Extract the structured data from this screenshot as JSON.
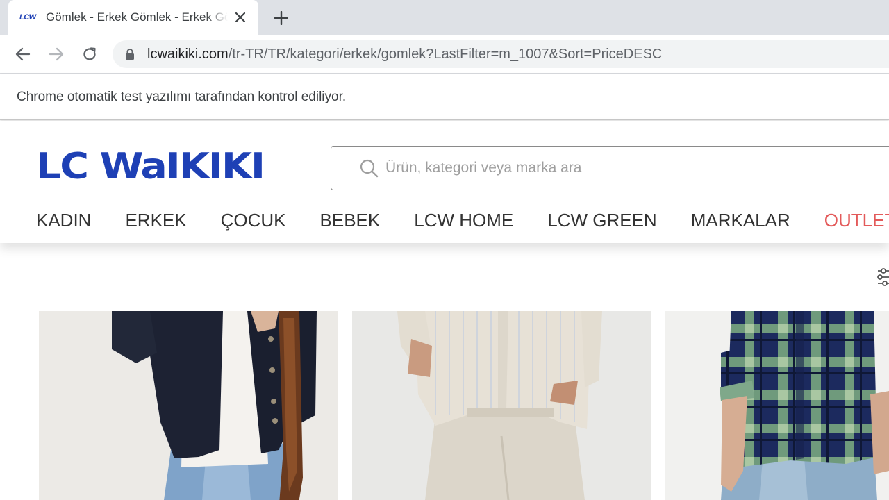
{
  "browser": {
    "tab": {
      "favicon_text": "LCW",
      "title": "Gömlek - Erkek Gömlek - Erkek Gömlek Modelleri"
    },
    "address_bar": {
      "host": "lcwaikiki.com",
      "path": "/tr-TR/TR/kategori/erkek/gomlek?LastFilter=m_1007&Sort=PriceDESC"
    },
    "infobar_text": "Chrome otomatik test yazılımı tarafından kontrol ediliyor."
  },
  "site": {
    "logo_text": "LC Waikiki",
    "brand_color": "#1e40b5",
    "search": {
      "placeholder": "Ürün, kategori veya marka ara",
      "value": ""
    },
    "nav": {
      "items": [
        {
          "label": "KADIN"
        },
        {
          "label": "ERKEK"
        },
        {
          "label": "ÇOCUK"
        },
        {
          "label": "BEBEK"
        },
        {
          "label": "LCW HOME"
        },
        {
          "label": "LCW GREEN"
        },
        {
          "label": "MARKALAR"
        },
        {
          "label": "OUTLET",
          "color": "#e35a5a"
        }
      ]
    },
    "filter_icon": "sliders-icon"
  },
  "products": [
    {
      "image": "navy-jacket-shirt-photo"
    },
    {
      "image": "beige-striped-shirt-photo"
    },
    {
      "image": "navy-green-plaid-shirt-photo"
    }
  ]
}
